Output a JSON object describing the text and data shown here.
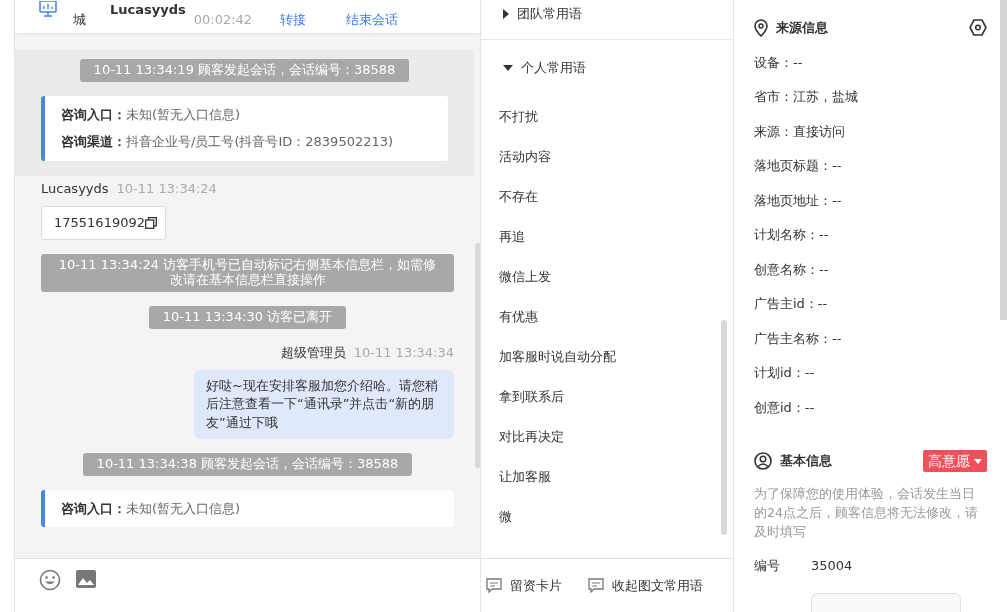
{
  "header": {
    "location": "城",
    "visitor": "Lucasyyds",
    "duration": "00:02:42",
    "actions": [
      "转接",
      "结束会话"
    ]
  },
  "chat": {
    "groups": [
      {
        "highlighted": true,
        "messages": [
          {
            "kind": "system",
            "text": "10-11 13:34:19 顾客发起会话，会话编号：38588"
          },
          {
            "kind": "entry",
            "rows": [
              {
                "label": "咨询入口：",
                "value": "未知(暂无入口信息)"
              },
              {
                "label": "咨询渠道：",
                "value": "抖音企业号/员工号(抖音号ID：2839502213)"
              }
            ]
          }
        ]
      },
      {
        "highlighted": false,
        "messages": [
          {
            "kind": "visitor",
            "sender": "Lucasyyds",
            "time": "10-11 13:34:24",
            "text": "17551619092"
          },
          {
            "kind": "system",
            "text": "10-11 13:34:24 访客手机号已自动标记右侧基本信息栏，如需修改请在基本信息栏直接操作"
          },
          {
            "kind": "system",
            "text": "10-11 13:34:30 访客已离开"
          },
          {
            "kind": "agent",
            "sender": "超级管理员",
            "time": "10-11 13:34:34",
            "text": "好哒~现在安排客服加您介绍哈。请您稍后注意查看一下“通讯录”并点击“新的朋友”通过下哦"
          },
          {
            "kind": "system",
            "text": "10-11 13:34:38 顾客发起会话，会话编号：38588"
          },
          {
            "kind": "entry",
            "rows": [
              {
                "label": "咨询入口：",
                "value": "未知(暂无入口信息)"
              }
            ]
          }
        ]
      }
    ]
  },
  "toolbar": {
    "actions": [
      "留资卡片",
      "收起图文常用语"
    ]
  },
  "phrases": {
    "groups": [
      {
        "label": "团队常用语",
        "expanded": false
      },
      {
        "label": "个人常用语",
        "expanded": true,
        "items": [
          "不打扰",
          "活动内容",
          "不存在",
          "再追",
          "微信上发",
          "有优惠",
          "加客服时说自动分配",
          "拿到联系后",
          "对比再决定",
          "让加客服",
          "微"
        ]
      }
    ]
  },
  "source_info": {
    "title": "来源信息",
    "fields": [
      "设备：--",
      "省市：江苏，盐城",
      "来源：直接访问",
      "落地页标题：--",
      "落地页地址：--",
      "计划名称：--",
      "创意名称：--",
      "广告主id：--",
      "广告主名称：--",
      "计划id：--",
      "创意id：--"
    ]
  },
  "basic_info": {
    "title": "基本信息",
    "tag": {
      "label": "高意愿",
      "color": "#f0505a"
    },
    "note": "为了保障您的使用体验，会话发生当日的24点之后，顾客信息将无法修改，请及时填写",
    "fields": [
      {
        "label": "编号",
        "value": "35004"
      }
    ]
  }
}
